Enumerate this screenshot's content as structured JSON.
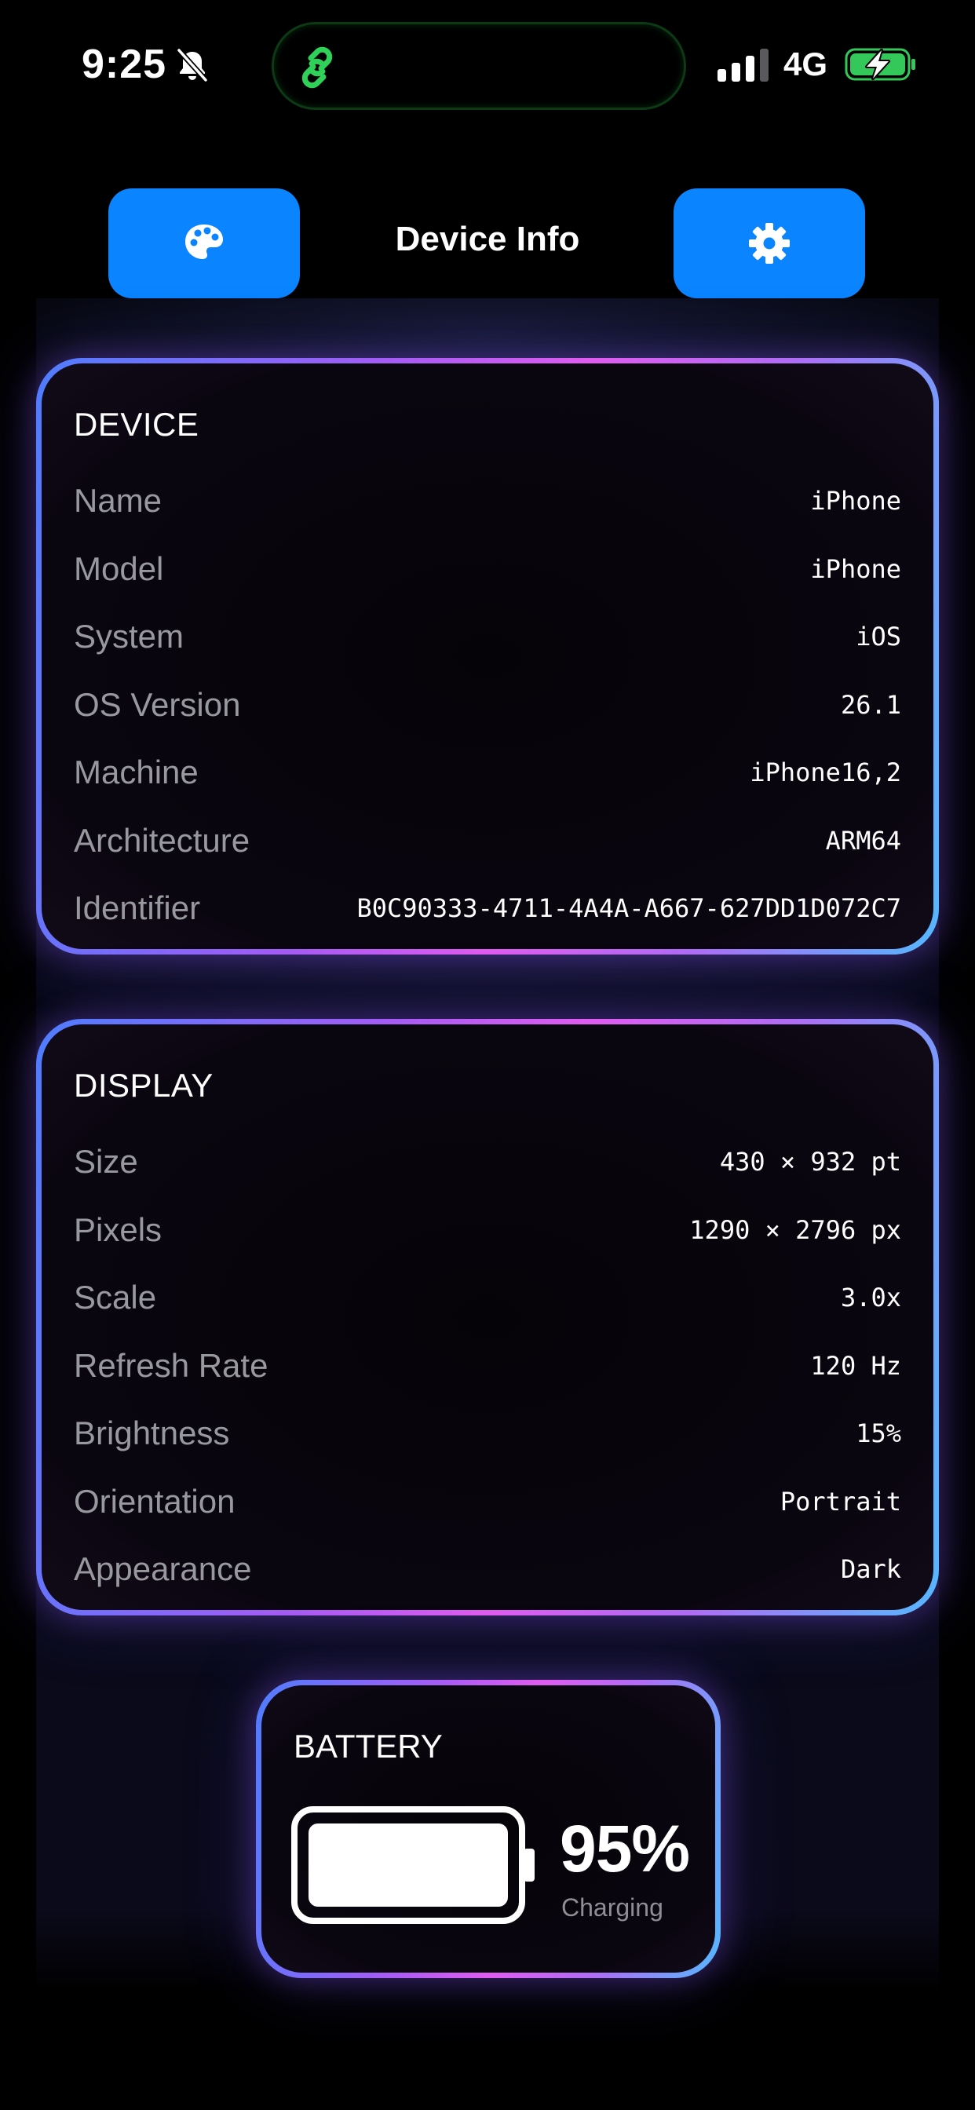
{
  "status_bar": {
    "time": "9:25",
    "network": "4G",
    "battery_color": "#34c759",
    "island_icon_color": "#30d158"
  },
  "header": {
    "title": "Device Info",
    "left_button_icon": "palette-icon",
    "right_button_icon": "gear-icon",
    "button_color": "#0a84ff"
  },
  "device": {
    "title": "DEVICE",
    "rows": [
      {
        "label": "Name",
        "value": "iPhone"
      },
      {
        "label": "Model",
        "value": "iPhone"
      },
      {
        "label": "System",
        "value": "iOS"
      },
      {
        "label": "OS Version",
        "value": "26.1"
      },
      {
        "label": "Machine",
        "value": "iPhone16,2"
      },
      {
        "label": "Architecture",
        "value": "ARM64"
      },
      {
        "label": "Identifier",
        "value": "B0C90333-4711-4A4A-A667-627DD1D072C7"
      }
    ]
  },
  "display": {
    "title": "DISPLAY",
    "rows": [
      {
        "label": "Size",
        "value": "430 × 932 pt"
      },
      {
        "label": "Pixels",
        "value": "1290 × 2796 px"
      },
      {
        "label": "Scale",
        "value": "3.0x"
      },
      {
        "label": "Refresh Rate",
        "value": "120 Hz"
      },
      {
        "label": "Brightness",
        "value": "15%"
      },
      {
        "label": "Orientation",
        "value": "Portrait"
      },
      {
        "label": "Appearance",
        "value": "Dark"
      }
    ]
  },
  "battery": {
    "title": "BATTERY",
    "percent": "95%",
    "level": 0.95,
    "state": "Charging"
  }
}
